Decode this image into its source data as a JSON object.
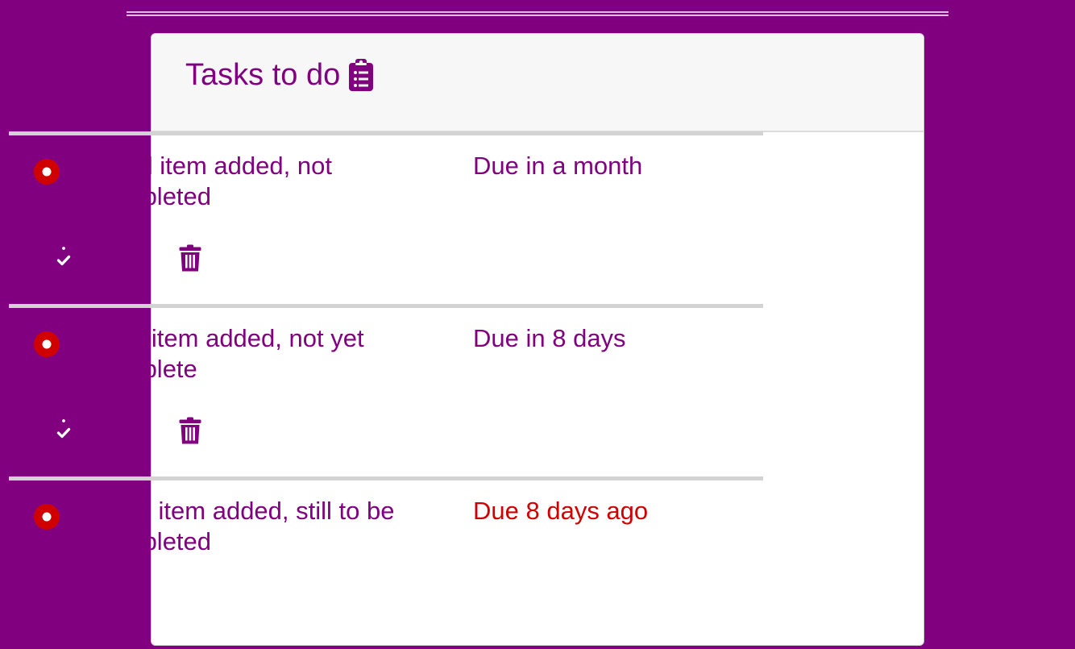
{
  "header": {
    "title": "Tasks to do",
    "title_icon": "clipboard-list-icon"
  },
  "colors": {
    "background": "#800080",
    "accent": "#800080",
    "overdue": "#d10000",
    "status_icon": "#d10000"
  },
  "tasks": [
    {
      "text": "Third item added, not completed",
      "due": "Due in a month",
      "overdue": false,
      "status_icon": "radio-dot-icon",
      "complete_icon": "clipboard-check-icon",
      "delete_icon": "trash-icon"
    },
    {
      "text": "Fifth item added, not yet complete",
      "due": "Due in 8 days",
      "overdue": false,
      "status_icon": "radio-dot-icon",
      "complete_icon": "clipboard-check-icon",
      "delete_icon": "trash-icon"
    },
    {
      "text": "Sixth item added, still to be completed",
      "due": "Due 8 days ago",
      "overdue": true,
      "status_icon": "radio-dot-icon",
      "complete_icon": "clipboard-check-icon",
      "delete_icon": "trash-icon"
    }
  ]
}
